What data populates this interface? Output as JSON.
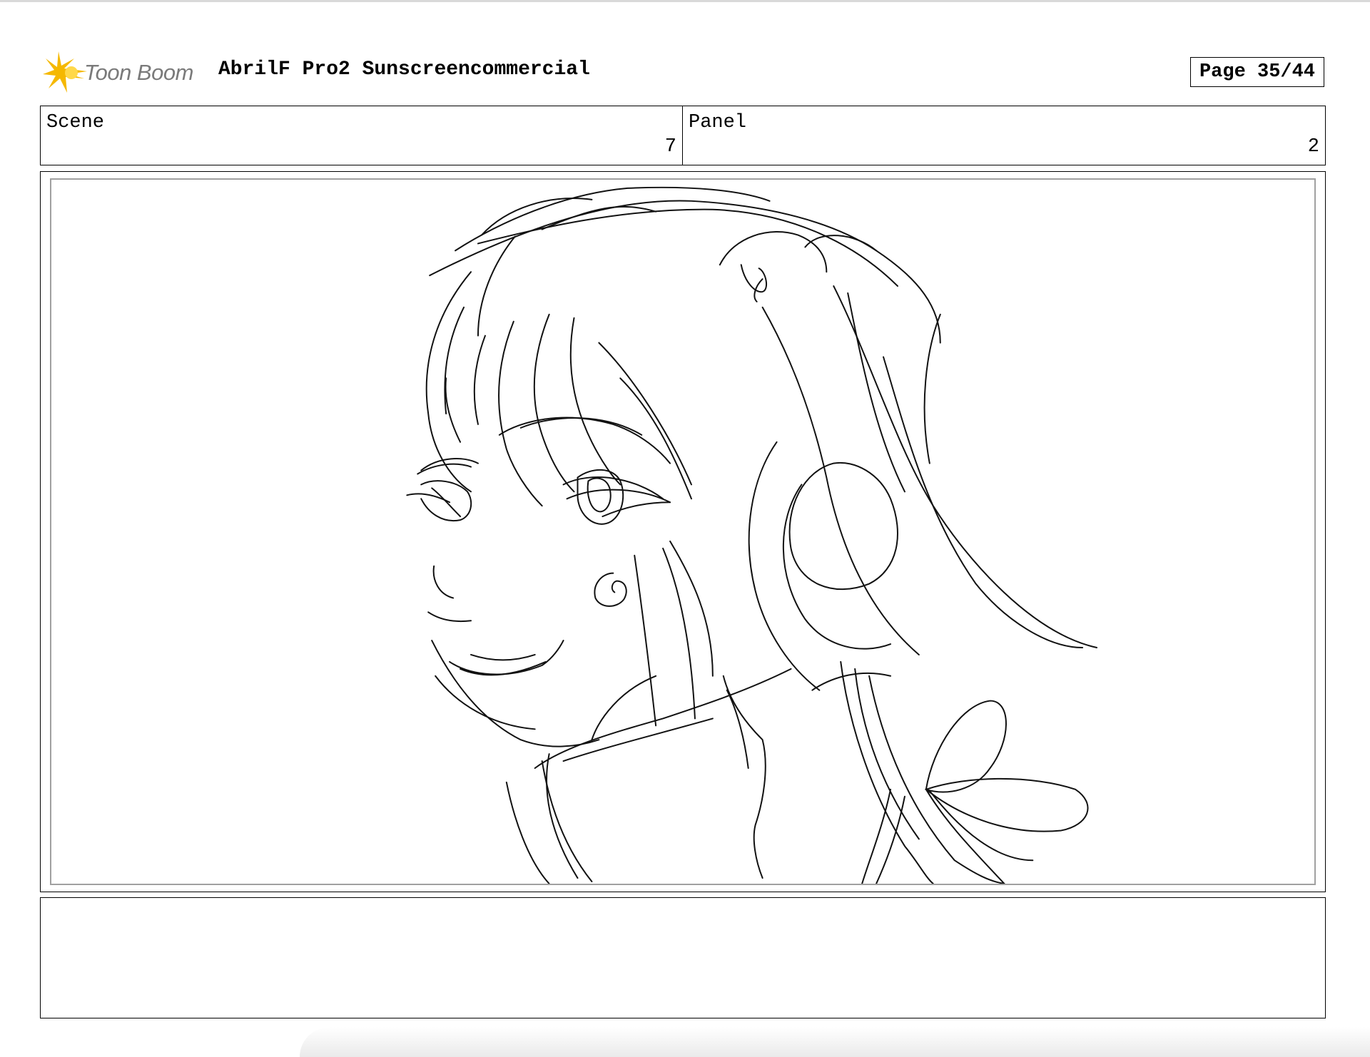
{
  "header": {
    "logo_text": "Toon Boom",
    "project_title": "AbrilF Pro2 Sunscreencommercial",
    "page_label": "Page 35/44"
  },
  "info": {
    "scene_label": "Scene",
    "scene_value": "7",
    "panel_label": "Panel",
    "panel_value": "2"
  },
  "notes": {
    "text": ""
  },
  "colors": {
    "logo_accent": "#F5B800",
    "logo_text": "#7a7a7a",
    "frame_border": "#000000",
    "inner_frame_border": "#a0a0a0",
    "sketch_stroke": "#111111"
  },
  "icons": {
    "logo": "toon-boom-star-icon"
  }
}
